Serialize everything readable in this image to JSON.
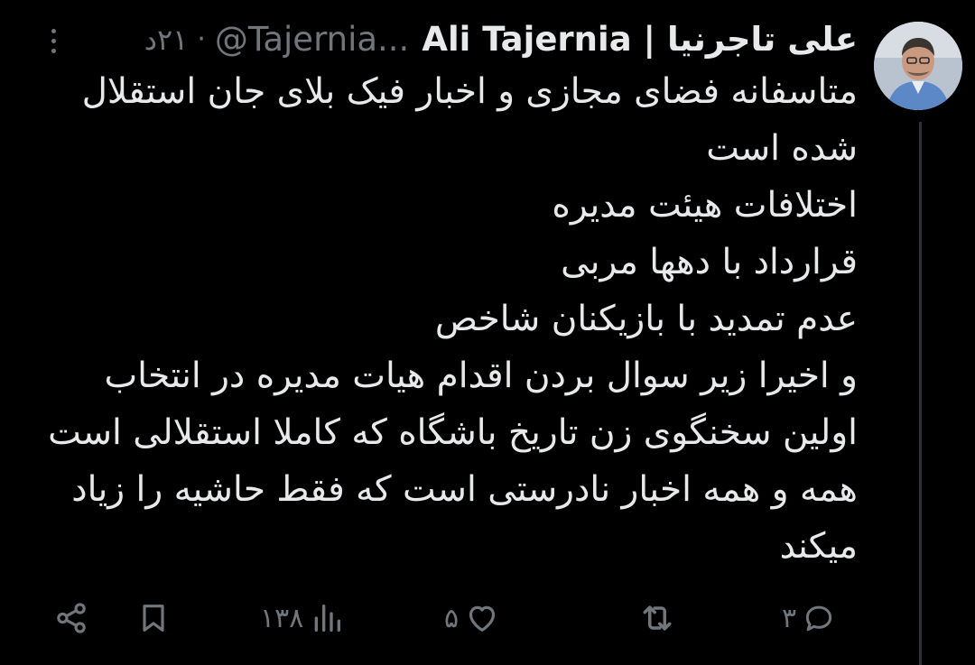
{
  "author": {
    "name": "علی تاجرنیا | Ali Tajernia",
    "handle": "@Tajernia...",
    "separator": "·",
    "time": "۲۱د"
  },
  "tweet": {
    "lines": [
      "متاسفانه فضای مجازی و اخبار فیک بلای جان استقلال شده است",
      "اختلافات هیئت مدیره",
      "قرارداد با دهها مربی",
      "عدم تمدید با بازیکنان شاخص",
      "و اخیرا زیر سوال بردن اقدام هیات مدیره در انتخاب اولین سخنگوی زن تاریخ باشگاه که کاملا استقلالی است همه و همه اخبار نادرستی است که فقط حاشیه را زیاد میکند"
    ]
  },
  "actions": {
    "replies": "۳",
    "retweets": "",
    "likes": "۵",
    "views": "۱۳۸"
  },
  "icons": {
    "more": "more-dots-icon",
    "reply": "reply-bubble-icon",
    "retweet": "retweet-icon",
    "like": "heart-icon",
    "views": "views-bar-icon",
    "bookmark": "bookmark-icon",
    "share": "share-icon"
  },
  "colors": {
    "background": "#000000",
    "text": "#e7e9ea",
    "muted": "#71767b",
    "thread_line": "#2f3336"
  }
}
